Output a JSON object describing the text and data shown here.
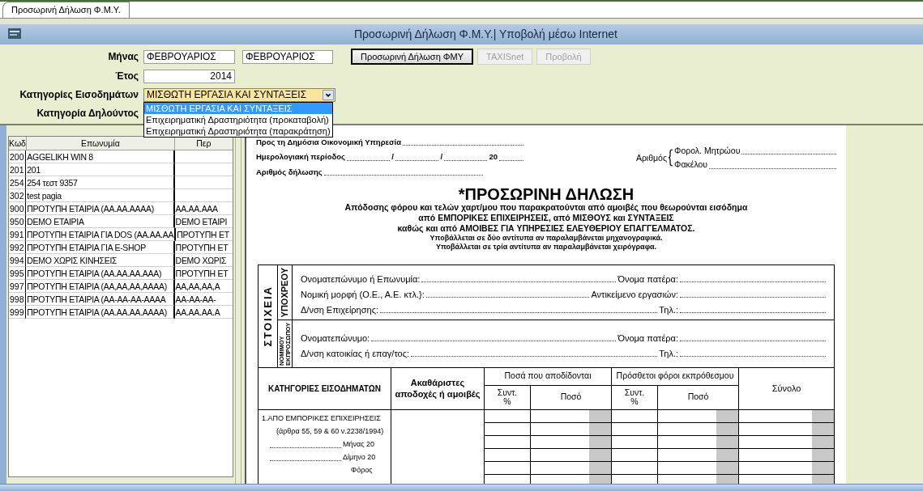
{
  "tab": {
    "label": "Προσωρινή Δήλωση Φ.Μ.Υ.",
    "selected": true
  },
  "header": {
    "title": "Προσωρινή Δήλωση Φ.Μ.Υ.| Υποβολή μέσω Internet"
  },
  "form": {
    "month": {
      "label": "Μήνας",
      "value_from": "ΦΕΒΡΟΥΑΡΙΟΣ",
      "value_to": "ΦΕΒΡΟΥΑΡΙΟΣ"
    },
    "year": {
      "label": "Έτος",
      "value": "2014"
    },
    "income_categories": {
      "label": "Κατηγορίες Εισοδημάτων",
      "value": "ΜΙΣΘΩΤΗ ΕΡΓΑΣΙΑ ΚΑΙ ΣΥΝΤΑΞΕΙΣ",
      "expanded": true,
      "options": [
        {
          "label": "ΜΙΣΘΩΤΗ ΕΡΓΑΣΙΑ ΚΑΙ ΣΥΝΤΑΞΕΙΣ",
          "selected": true
        },
        {
          "label": "Επιχειρηματική Δραστηριότητα (προκαταβολή)",
          "selected": false
        },
        {
          "label": "Επιχειρηματική Δραστηριότητα (παρακράτηση)",
          "selected": false
        }
      ]
    },
    "declarant_category": {
      "label": "Κατηγορία Δηλούντος"
    }
  },
  "buttons": [
    {
      "label": "Προσωρινή Δήλωση ΦΜΥ",
      "disabled": false,
      "focused": true
    },
    {
      "label": "TAXISnet",
      "disabled": true,
      "focused": false
    },
    {
      "label": "Προβολή",
      "disabled": true,
      "focused": false
    }
  ],
  "companies": {
    "columns": [
      "Κωδ",
      "Επωνυμία",
      "Περ"
    ],
    "rows": [
      {
        "code": "200",
        "name": "AGGELIKH WIN 8",
        "column_3": ""
      },
      {
        "code": "201",
        "name": "201",
        "column_3": ""
      },
      {
        "code": "254",
        "name": "254 τεστ 9357",
        "column_3": ""
      },
      {
        "code": "302",
        "name": "test pagia",
        "column_3": ""
      },
      {
        "code": "900",
        "name": "ΠΡΟΤΥΠΗ  ΕΤΑΙΡΙΑ (ΑΑ.ΑΑ.ΑΑΑΑ)",
        "column_3": "ΑΑ.ΑΑ.ΑΑΑ"
      },
      {
        "code": "950",
        "name": "DEMO ΕΤΑΙΡΙΑ",
        "column_3": "DEMO ΕΤΑΙΡΙ"
      },
      {
        "code": "991",
        "name": "ΠΡΟΤΥΠΗ ΕΤΑΙΡΙΑ ΓΙΑ DOS (ΑΑ.ΑΑ.ΑΑ",
        "column_3": "ΠΡΟΤΥΠΗ ΕΤ"
      },
      {
        "code": "992",
        "name": "ΠΡΟΤΥΠΗ ΕΤΑΙΡΙΑ ΓΙΑ E-SHOP",
        "column_3": "ΠΡΟΤΥΠΗ ΕΤ"
      },
      {
        "code": "994",
        "name": "DEMO ΧΩΡΙΣ ΚΙΝΗΣΕΙΣ",
        "column_3": "DEMO ΧΩΡΙΣ"
      },
      {
        "code": "995",
        "name": "ΠΡΟΤΥΠΗ ΕΤΑΙΡΙΑ (ΑΑ.ΑΑ.ΑΑ.ΑΑΑ)",
        "column_3": "ΠΡΟΤΥΠΗ ΕΤ"
      },
      {
        "code": "997",
        "name": "ΠΡΟΤΥΠΗ ΕΤΑΙΡΙΑ (ΑΑ,ΑΑ,ΑΑ,ΑΑΑΑ)",
        "column_3": "ΑΑ,ΑΑ,ΑΑ,Α"
      },
      {
        "code": "998",
        "name": "ΠΡΟΤΥΠΗ ΕΤΑΙΡΙΑ (ΑΑ-ΑΑ-ΑΑ-ΑΑΑΑ",
        "column_3": "ΑΑ-ΑΑ-ΑΑ-"
      },
      {
        "code": "999",
        "name": "ΠΡΟΤΥΠΗ ΕΤΑΙΡΙΑ (ΑΑ.ΑΑ.ΑΑ.ΑΑΑΑ)",
        "column_3": "ΑΑ.ΑΑ.ΑΑ.Α"
      }
    ]
  },
  "document": {
    "office": {
      "label": "Προς τη Δημόσια Οικονομική Υπηρεσία"
    },
    "period": {
      "label": "Ημερολογιακή περίοδος",
      "separators": [
        "/",
        "/",
        "20"
      ]
    },
    "declaration_number": {
      "label": "Αριθμός δήλωσης"
    },
    "number": {
      "label": "Αριθμός",
      "entries": [
        "Φορολ. Μητρώου",
        "Φακέλου"
      ]
    },
    "title": "*ΠΡΟΣΩΡΙΝΗ ΔΗΛΩΣΗ",
    "subtitle_lines": [
      "Απόδοσης φόρου και τελών χαρτ/μου που παρακρατούνται από αμοιβές που θεωρούνται εισόδημα",
      "από ΕΜΠΟΡΙΚΕΣ ΕΠΙΧΕΙΡΗΣΕΙΣ, από ΜΙΣΘΟΥΣ και ΣΥΝΤΑΞΕΙΣ",
      "καθώς και από ΑΜΟΙΒΕΣ ΓΙΑ ΥΠΗΡΕΣΙΕΣ ΕΛΕΥΘΕΡΙΟΥ ΕΠΑΓΓΕΛΜΑΤΟΣ."
    ],
    "notes": [
      "Υποβάλλεται σε δύο αντίτυπα αν παραλαμβάνεται μηχανογραφικά.",
      "Υποβάλλεται σε τρία αντίτυπα αν παραλαμβάνεται χειρόγραφα."
    ],
    "details": {
      "label": "ΣΤΟΙΧΕΙΑ",
      "groups": [
        {
          "label": "ΥΠΟΧΡΕΟΥ",
          "lines": [
            [
              "Ονοματεπώνυμο ή Επωνυμία:",
              "Όνομα πατέρα:"
            ],
            [
              "Νομική μορφή (Ο.Ε., Α.Ε. κτλ.}:",
              "Αντικείμενο εργασιών:"
            ],
            [
              "Δ/νση Επιχείρησης:",
              "Τηλ.:"
            ]
          ]
        },
        {
          "label": "ΝΟΜΙΜΟΥ ΕΚΠΡΟΣΩΠΟΥ",
          "lines": [
            [
              "Ονοματεπώνυμο:",
              "Όνομα πατέρα:"
            ],
            [
              "Δ/νση κατοικίας ή επαγ/τος:",
              "Τηλ.:"
            ]
          ]
        }
      ]
    },
    "table": {
      "category": "ΚΑΤΗΓΟΡΙΕΣ ΕΙΣΟΔΗΜΑΤΩΝ",
      "gross": "Ακαθάριστες αποδοχές ή αμοιβές",
      "paid": {
        "label": "Ποσά που αποδίδονται",
        "rate": "Συντ. %",
        "amount": "Ποσό"
      },
      "late": {
        "label": "Πρόσθετοι φόροι εκπρόθεσμου",
        "rate": "Συντ. %",
        "amount": "Ποσό"
      },
      "total": "Σύνολο",
      "row_labels": [
        {
          "kind": "heading",
          "text": "1.ΑΠΟ ΕΜΠΟΡΙΚΕΣ ΕΠΙΧΕΙΡΗΣΕΙΣ"
        },
        {
          "kind": "note",
          "text": "(άρθρα 55, 59 & 60 ν.2238/1994)"
        },
        {
          "kind": "dotted",
          "text": "Μήνας 20"
        },
        {
          "kind": "dotted",
          "text": "Δίμηνο 20"
        },
        {
          "kind": "plain",
          "text": "Φόρος"
        }
      ]
    }
  }
}
